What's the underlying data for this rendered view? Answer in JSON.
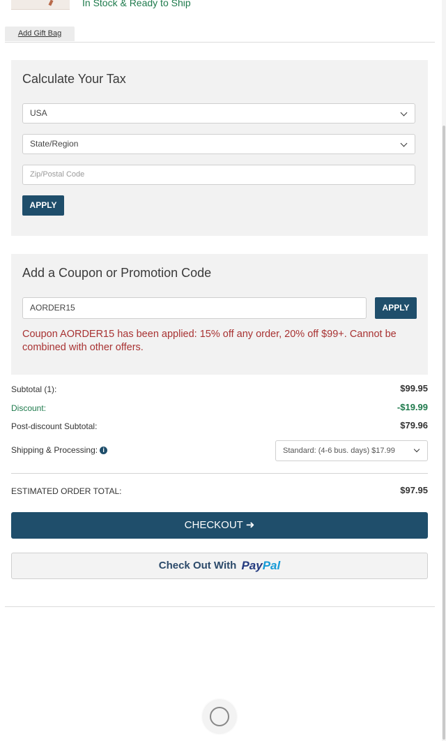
{
  "product": {
    "stock_status": "In Stock & Ready to Ship",
    "gift_bag_label": "Add Gift Bag"
  },
  "tax": {
    "title": "Calculate Your Tax",
    "country": "USA",
    "state_placeholder": "State/Region",
    "zip_placeholder": "Zip/Postal Code",
    "apply_label": "APPLY"
  },
  "coupon": {
    "title": "Add a Coupon or Promotion Code",
    "code_value": "AORDER15",
    "apply_label": "APPLY",
    "message": "Coupon AORDER15 has been applied: 15% off any order, 20% off $99+. Cannot be combined with other offers.",
    "message_color": "#a83232"
  },
  "summary": {
    "subtotal_label": "Subtotal (1):",
    "subtotal_value": "$99.95",
    "discount_label": "Discount:",
    "discount_value": "-$19.99",
    "discount_color": "#1e7a4c",
    "post_discount_label": "Post-discount Subtotal:",
    "post_discount_value": "$79.96",
    "shipping_label": "Shipping & Processing:",
    "shipping_info_icon": "info-icon",
    "shipping_option": "Standard: (4-6 bus. days) $17.99",
    "total_label": "ESTIMATED ORDER TOTAL:",
    "total_value": "$97.95"
  },
  "actions": {
    "checkout_label": "CHECKOUT",
    "checkout_icon": "arrow-right-icon",
    "paypal_prefix": "Check Out With",
    "paypal_logo_pay": "Pay",
    "paypal_logo_pal": "Pal"
  },
  "colors": {
    "brand": "#1f4e6b",
    "success": "#1e7a4c",
    "panel_bg": "#f2f2f2"
  }
}
